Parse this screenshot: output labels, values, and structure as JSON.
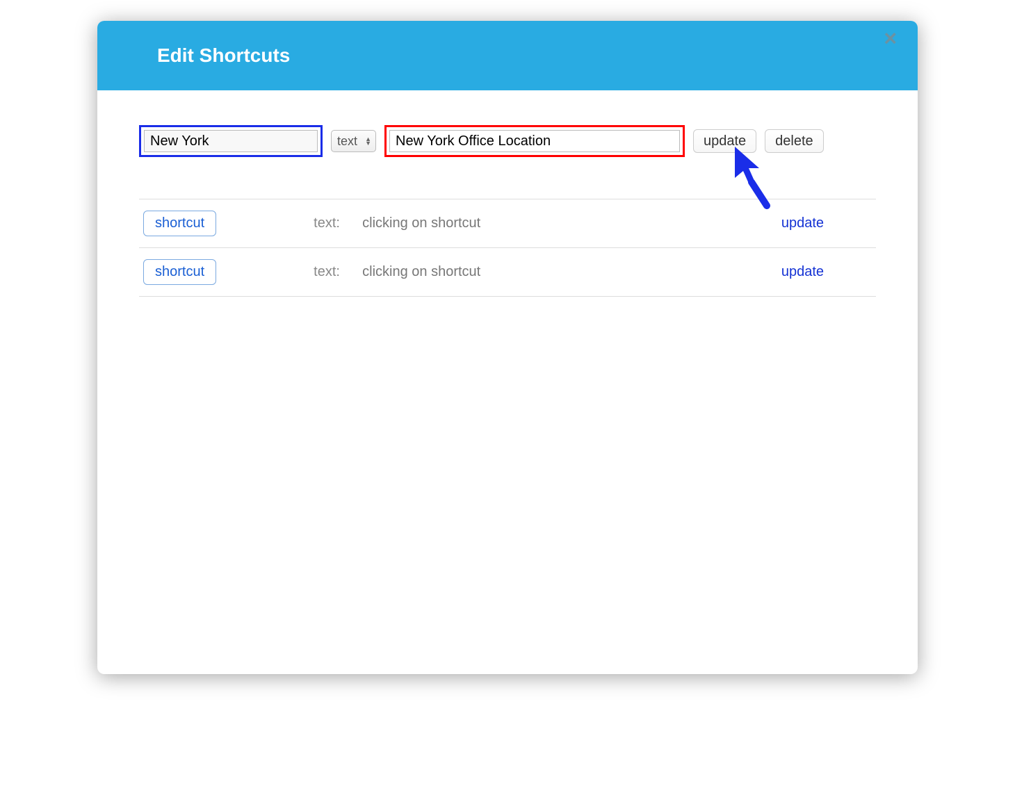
{
  "modal": {
    "title": "Edit Shortcuts",
    "close_symbol": "×"
  },
  "editor": {
    "name_value": "New York",
    "type_label": "text",
    "content_value": "New York Office Location",
    "update_label": "update",
    "delete_label": "delete"
  },
  "list": {
    "rows": [
      {
        "shortcut_label": "shortcut",
        "type_label": "text:",
        "description": "clicking on shortcut",
        "action_label": "update"
      },
      {
        "shortcut_label": "shortcut",
        "type_label": "text:",
        "description": "clicking on shortcut",
        "action_label": "update"
      }
    ]
  }
}
